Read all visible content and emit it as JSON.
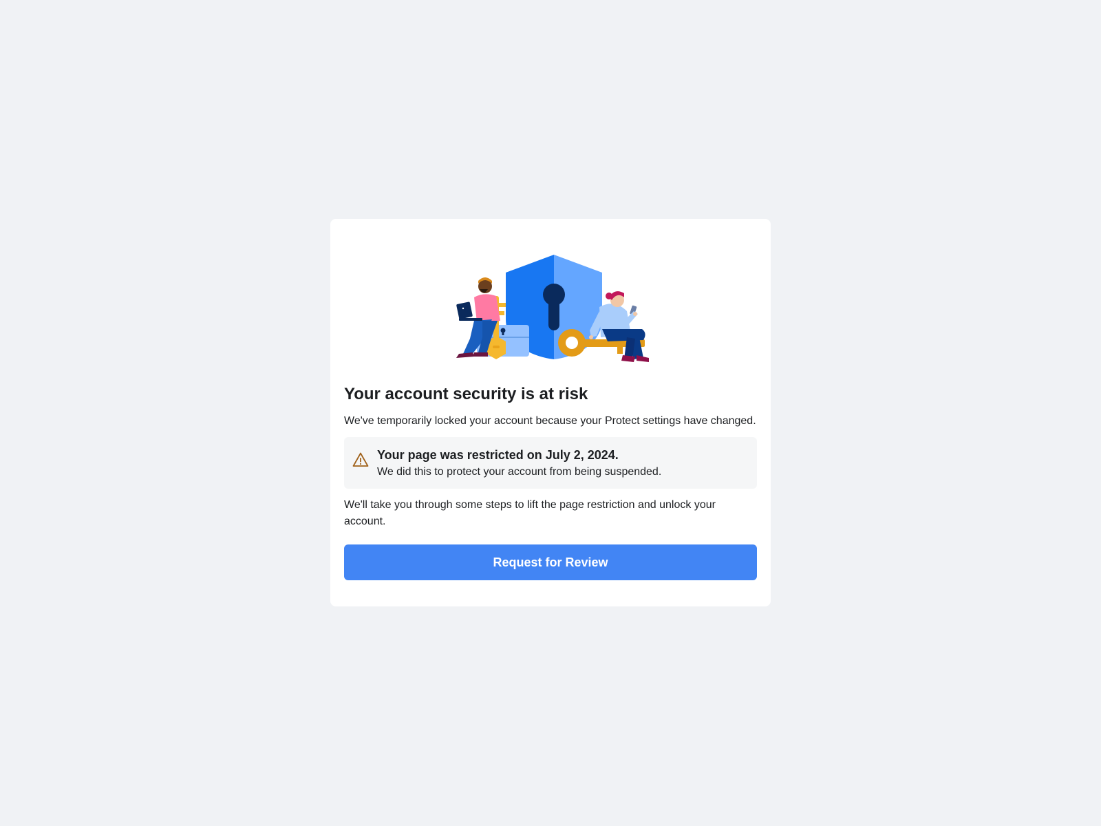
{
  "card": {
    "illustration": "account-security-illustration",
    "title": "Your account security is at risk",
    "intro": "We've temporarily locked your account because your Protect settings have changed.",
    "notice": {
      "icon": "warning-triangle-icon",
      "title": "Your page was restricted on July 2, 2024.",
      "description": "We did this to protect your account from being suspended."
    },
    "steps_text": "We'll take you through some steps to lift the page restriction and unlock your account.",
    "cta_label": "Request for Review"
  },
  "colors": {
    "page_background": "#f0f2f5",
    "card_background": "#ffffff",
    "notice_background": "#f5f6f7",
    "button": "#4285f4",
    "warning_icon": "#a0611a",
    "shield_dark": "#1877f2",
    "shield_light": "#5aa2ff"
  }
}
